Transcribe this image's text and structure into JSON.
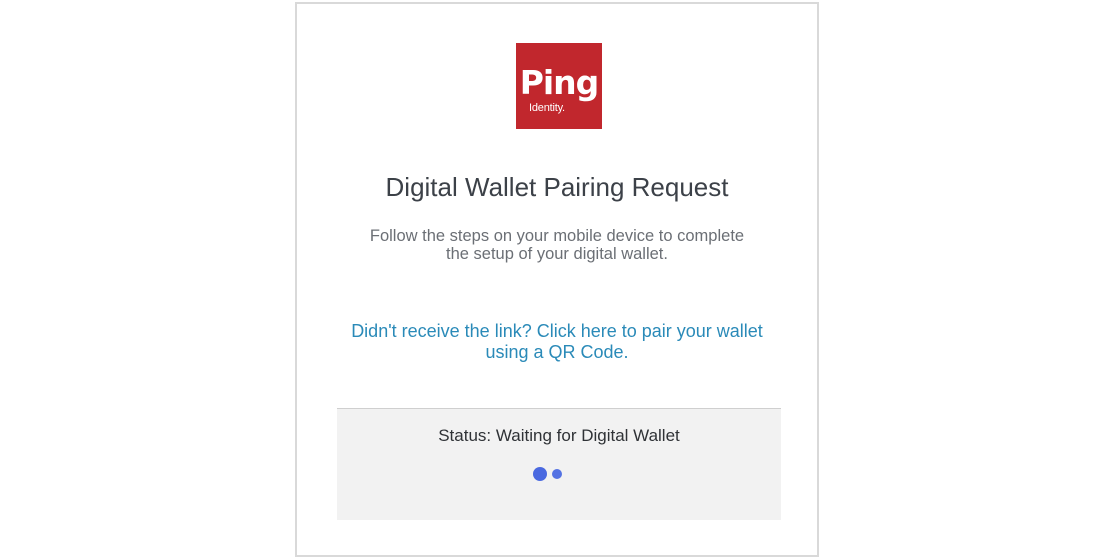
{
  "logo": {
    "main_text": "Ping",
    "sub_text": "Identity.",
    "color": "#c1272d"
  },
  "title": "Digital Wallet Pairing Request",
  "description": "Follow the steps on your mobile device to complete the setup of your digital wallet.",
  "qr_link": "Didn't receive the link? Click here to pair your wallet using a QR Code.",
  "status": {
    "text": "Status: Waiting for Digital Wallet",
    "indicator": "loading-dots",
    "indicator_color": "#4a69e0"
  },
  "colors": {
    "link": "#2a8ab8",
    "title": "#3c4148",
    "panel": "#f2f2f2"
  }
}
